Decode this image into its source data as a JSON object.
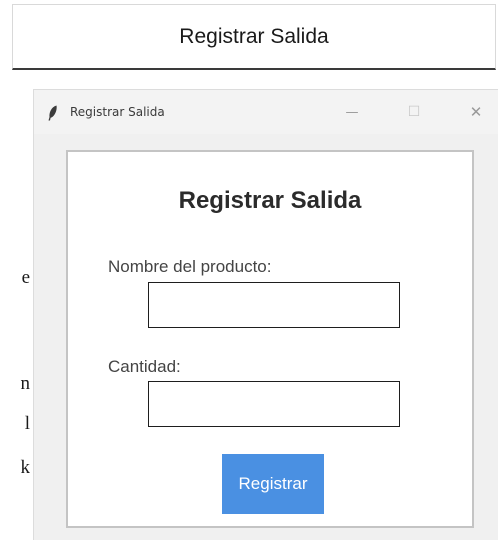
{
  "background": {
    "top_button_label": "Registrar Salida",
    "clipped_letters": [
      "e",
      "n",
      "l",
      "k"
    ]
  },
  "window": {
    "title": "Registrar Salida",
    "controls": {
      "minimize": "—",
      "maximize": "☐",
      "close": "✕"
    }
  },
  "form": {
    "heading": "Registrar Salida",
    "product_label": "Nombre del producto:",
    "product_value": "",
    "quantity_label": "Cantidad:",
    "quantity_value": "",
    "submit_label": "Registrar"
  },
  "colors": {
    "submit_bg": "#4a90e2",
    "panel_border": "#c4c4c4"
  },
  "icons": {
    "app": "feather-icon"
  }
}
